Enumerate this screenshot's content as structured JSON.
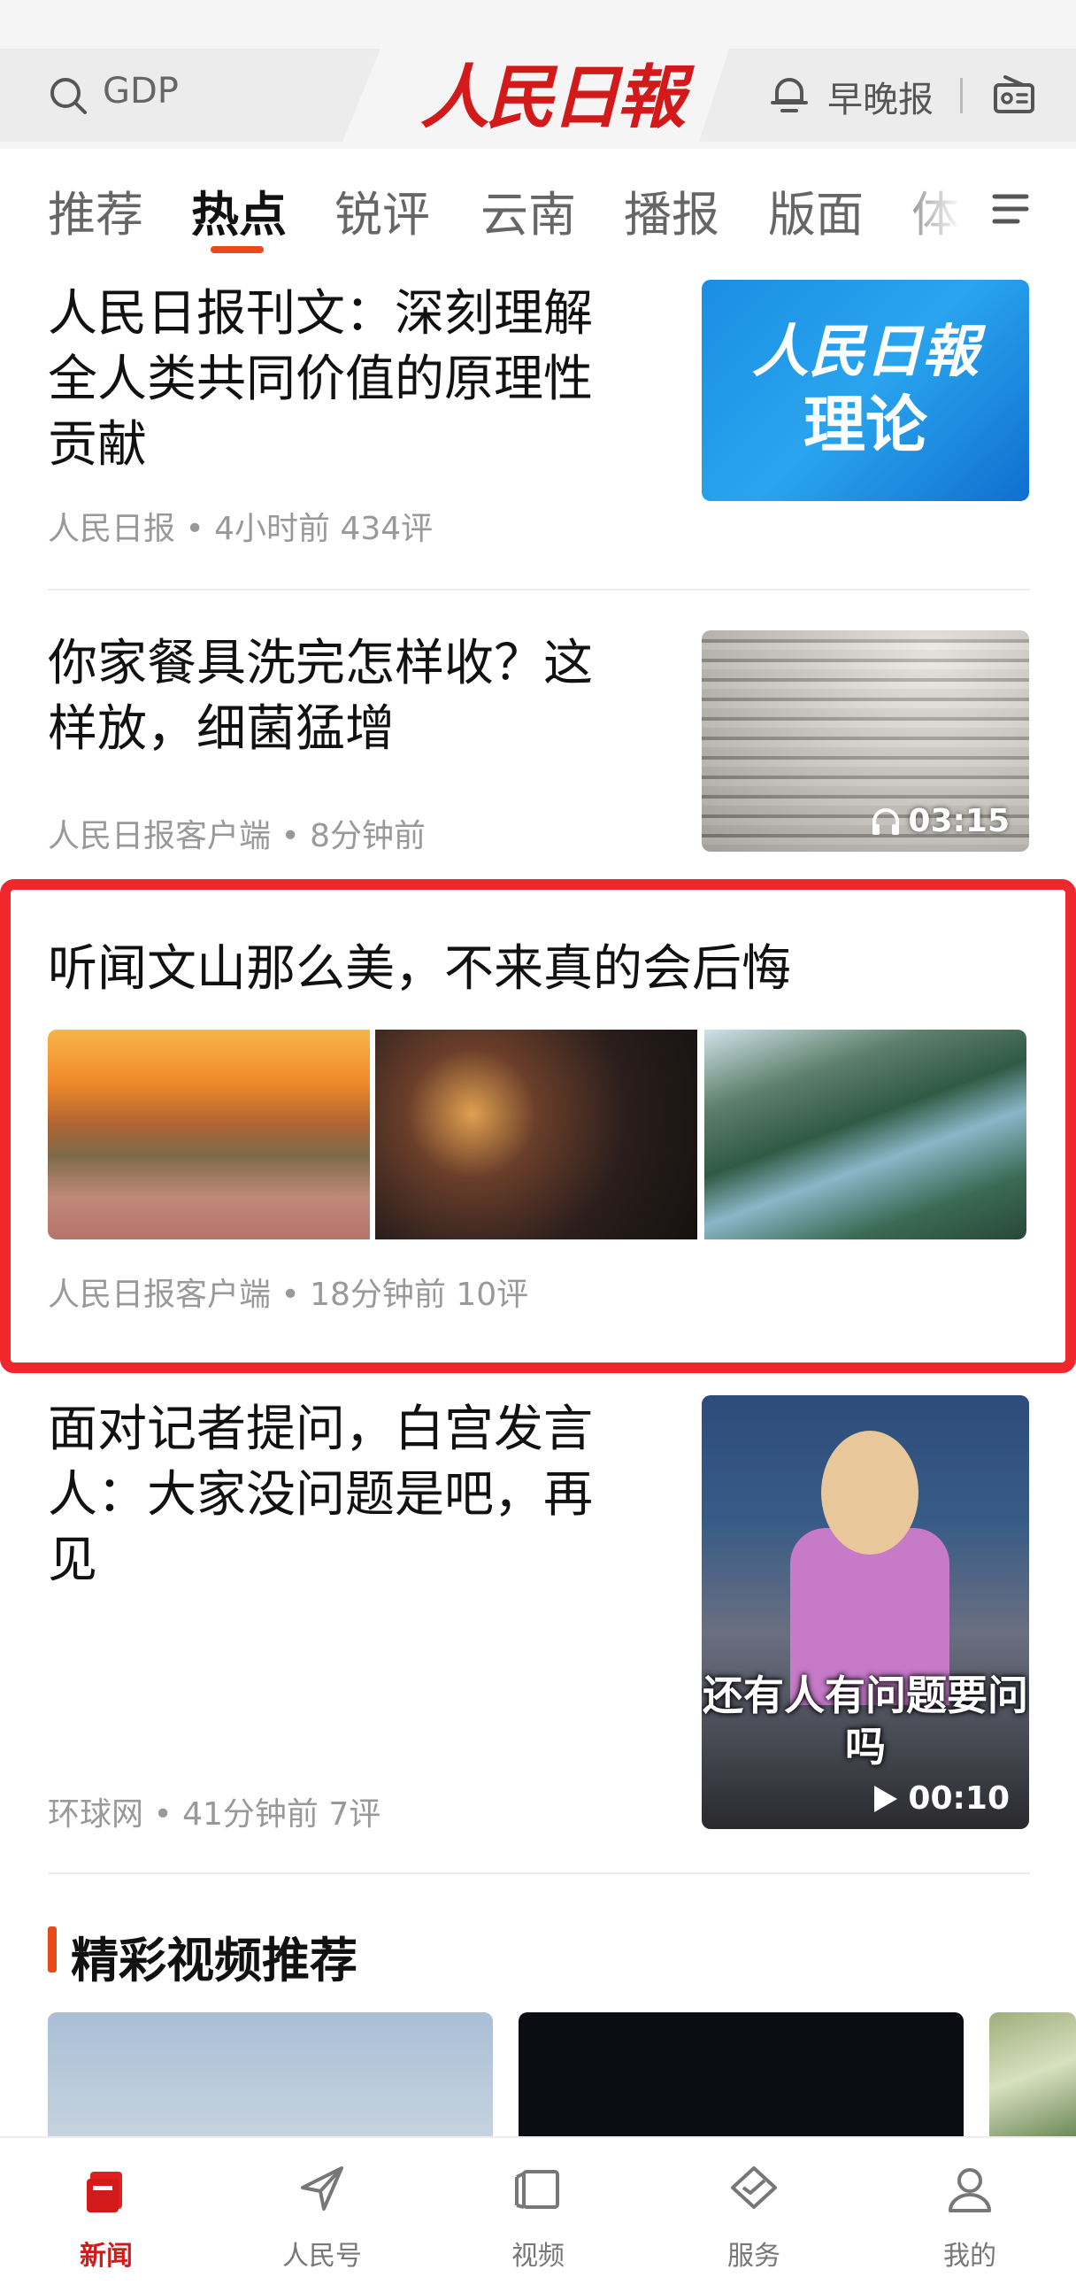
{
  "header": {
    "search_placeholder": "GDP",
    "brand": "人民日報",
    "evening_label": "早晚报"
  },
  "tabs": [
    {
      "label": "推荐",
      "active": false
    },
    {
      "label": "热点",
      "active": true
    },
    {
      "label": "锐评",
      "active": false
    },
    {
      "label": "云南",
      "active": false
    },
    {
      "label": "播报",
      "active": false
    },
    {
      "label": "版面",
      "active": false
    },
    {
      "label": "体",
      "active": false
    }
  ],
  "articles": [
    {
      "title": "人民日报刊文：深刻理解全人类共同价值的原理性贡献",
      "meta": "人民日报 • 4小时前  434评",
      "thumb_logo": "人民日報",
      "thumb_sub": "理论"
    },
    {
      "title": "你家餐具洗完怎样收？这样放，细菌猛增",
      "meta": "人民日报客户端 • 8分钟前",
      "duration": "03:15"
    },
    {
      "title": "听闻文山那么美，不来真的会后悔",
      "meta": "人民日报客户端 • 18分钟前  10评"
    },
    {
      "title": "面对记者提问，白宫发言人：大家没问题是吧，再见",
      "meta": "环球网 • 41分钟前  7评",
      "caption": "还有人有问题要问吗",
      "duration": "00:10"
    }
  ],
  "video_section": {
    "title": "精彩视频推荐"
  },
  "bottom_nav": [
    {
      "label": "新闻",
      "icon": "news-icon",
      "active": true
    },
    {
      "label": "人民号",
      "icon": "send-icon",
      "active": false
    },
    {
      "label": "视频",
      "icon": "video-icon",
      "active": false
    },
    {
      "label": "服务",
      "icon": "service-icon",
      "active": false
    },
    {
      "label": "我的",
      "icon": "profile-icon",
      "active": false
    }
  ],
  "colors": {
    "brand_red": "#d21a1a",
    "accent_orange": "#e84a1a",
    "highlight_red": "#f0282d"
  }
}
